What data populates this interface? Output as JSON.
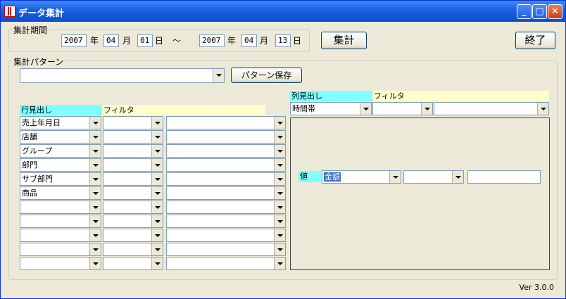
{
  "window": {
    "title": "データ集計",
    "minimize": "_",
    "maximize": "□",
    "close": "✕"
  },
  "period": {
    "legend": "集計期間",
    "from": {
      "year": "2007",
      "month": "04",
      "day": "01"
    },
    "to": {
      "year": "2007",
      "month": "04",
      "day": "13"
    },
    "year_unit": "年",
    "month_unit": "月",
    "day_unit": "日",
    "tilde": "～"
  },
  "buttons": {
    "aggregate": "集計",
    "exit": "終了",
    "save_pattern": "パターン保存"
  },
  "pattern": {
    "legend": "集計パターン",
    "value": ""
  },
  "row_headers": {
    "label": "行見出し",
    "filter": "フィルタ",
    "rows": [
      "売上年月日",
      "店舗",
      "グループ",
      "部門",
      "サブ部門",
      "商品",
      "",
      "",
      "",
      "",
      ""
    ]
  },
  "col_headers": {
    "label": "列見出し",
    "filter": "フィルタ",
    "value": "時間帯"
  },
  "value_section": {
    "label": "値",
    "value": "金額"
  },
  "version": "Ver 3.0.0"
}
